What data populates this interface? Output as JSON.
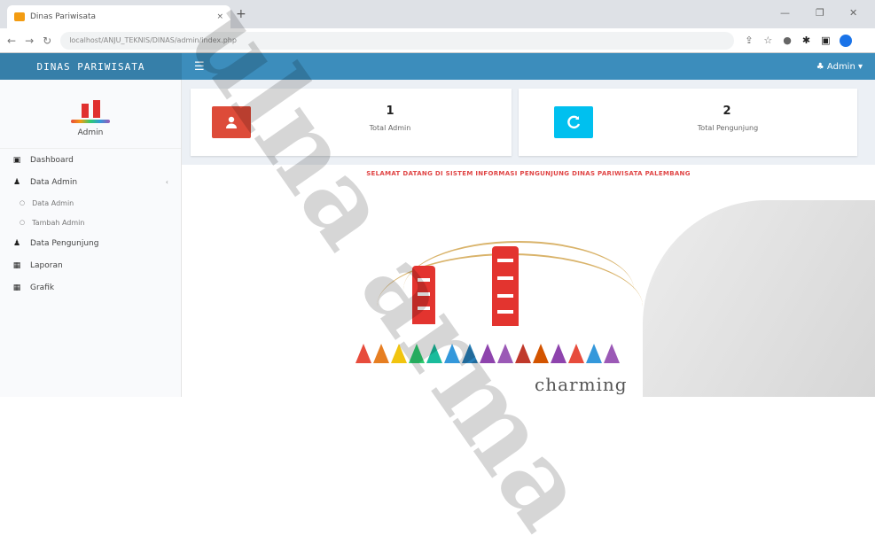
{
  "browser": {
    "tab_title": "Dinas Pariwisata",
    "tab_close": "×",
    "new_tab": "+",
    "url": "localhost/ANJU_TEKNIS/DINAS/admin/index.php",
    "win_min": "—",
    "win_max": "❐",
    "win_close": "✕"
  },
  "header": {
    "brand": "DINAS PARIWISATA",
    "menu_icon": "☰",
    "user_label": "♣ Admin ▾"
  },
  "sidebar": {
    "user_name": "Admin",
    "items": [
      {
        "label": "Dashboard",
        "icon": "▣"
      },
      {
        "label": "Data Admin",
        "icon": "♟",
        "chevron": "‹"
      },
      {
        "label": "Data Pengunjung",
        "icon": "♟"
      },
      {
        "label": "Laporan",
        "icon": "▦"
      },
      {
        "label": "Grafik",
        "icon": "▦"
      }
    ],
    "sub_items": [
      {
        "label": "Data Admin",
        "bullet": "○"
      },
      {
        "label": "Tambah Admin",
        "bullet": "○"
      }
    ]
  },
  "stats": [
    {
      "value": "1",
      "label": "Total Admin",
      "icon": "user-icon",
      "color": "#dd4b39"
    },
    {
      "value": "2",
      "label": "Total Pengunjung",
      "icon": "refresh-icon",
      "color": "#00c0ef"
    }
  ],
  "welcome": {
    "text": "SELAMAT DATANG DI SISTEM INFORMASI PENGUNJUNG DINAS PARIWISATA PALEMBANG"
  },
  "logo": {
    "tagline": "charming"
  },
  "watermark": {
    "text": "ulna arma"
  }
}
